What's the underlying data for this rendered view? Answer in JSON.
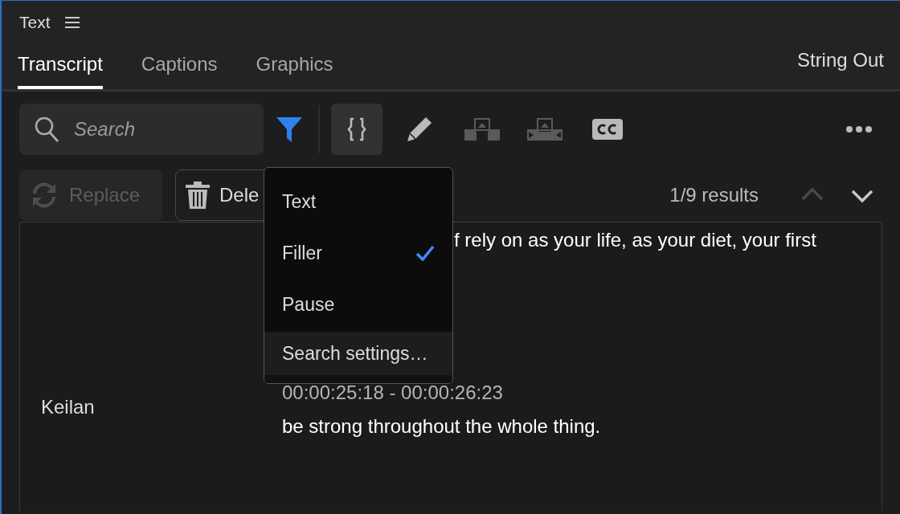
{
  "panel": {
    "title": "Text"
  },
  "tabs": [
    {
      "label": "Transcript",
      "selected": true
    },
    {
      "label": "Captions",
      "selected": false
    },
    {
      "label": "Graphics",
      "selected": false
    }
  ],
  "string_out": "String Out",
  "search": {
    "placeholder": "Search"
  },
  "filter": {
    "active": true
  },
  "tools": [
    {
      "kind": "brackets",
      "selected": true,
      "disabled": false
    },
    {
      "kind": "pencil",
      "selected": false,
      "disabled": false
    },
    {
      "kind": "insert",
      "selected": false,
      "disabled": true
    },
    {
      "kind": "overwrite",
      "selected": false,
      "disabled": true
    },
    {
      "kind": "cc",
      "selected": false,
      "disabled": false
    }
  ],
  "replace_button": {
    "label": "Replace",
    "disabled": true
  },
  "delete_button": {
    "label": "Dele"
  },
  "results": "1/9 results",
  "prev_result": {
    "disabled": true
  },
  "next_result": {
    "disabled": false
  },
  "filter_menu": {
    "items": [
      {
        "label": "Text",
        "checked": false
      },
      {
        "label": "Filler",
        "checked": true
      },
      {
        "label": "Pause",
        "checked": false
      }
    ],
    "settings": "Search settings…"
  },
  "transcript": [
    {
      "text": "f rely on as your life, as your diet, your first"
    },
    {
      "speaker": "Keilan",
      "time": "00:00:25:18 - 00:00:26:23",
      "text": "be strong throughout the whole thing."
    }
  ]
}
